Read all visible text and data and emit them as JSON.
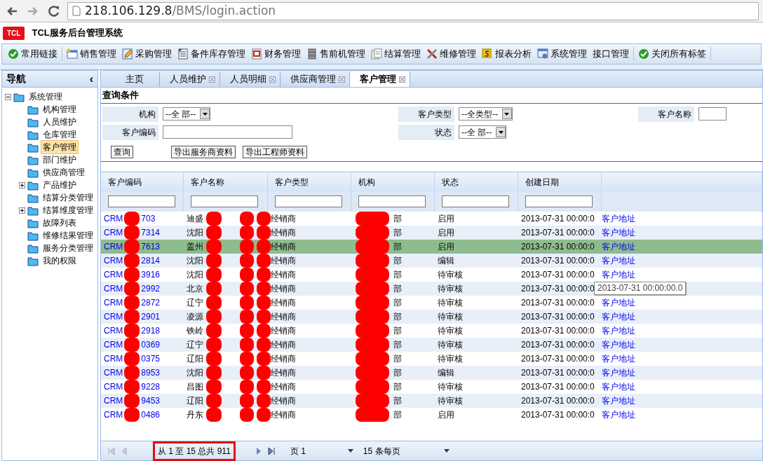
{
  "browser": {
    "url_host": "218.106.129.8",
    "url_path": "/BMS/login.action"
  },
  "app": {
    "logo": "TCL",
    "title": "TCL服务后台管理系统"
  },
  "toolbar": [
    {
      "label": "常用链接"
    },
    {
      "label": "销售管理"
    },
    {
      "label": "采购管理"
    },
    {
      "label": "备件库存管理"
    },
    {
      "label": "财务管理"
    },
    {
      "label": "售前机管理"
    },
    {
      "label": "结算管理"
    },
    {
      "label": "维修管理"
    },
    {
      "label": "报表分析"
    },
    {
      "label": "系统管理"
    },
    {
      "label": "接口管理"
    },
    {
      "label": "关闭所有标签"
    }
  ],
  "sidebar": {
    "title": "导航",
    "collapse": "‹",
    "tree": [
      {
        "label": "系统管理",
        "expanded": true,
        "selected": false,
        "children": [
          {
            "label": "机构管理",
            "selected": false
          },
          {
            "label": "人员维护",
            "selected": false
          },
          {
            "label": "仓库管理",
            "selected": false
          },
          {
            "label": "客户管理",
            "selected": true
          },
          {
            "label": "部门维护",
            "selected": false
          },
          {
            "label": "供应商管理",
            "selected": false
          },
          {
            "label": "产品维护",
            "expanded": false,
            "selected": false
          },
          {
            "label": "结算分类管理",
            "selected": false
          },
          {
            "label": "结算维度管理",
            "expanded": false,
            "selected": false
          },
          {
            "label": "故障列表",
            "selected": false
          },
          {
            "label": "维修结果管理",
            "selected": false
          },
          {
            "label": "服务分类管理",
            "selected": false
          },
          {
            "label": "我的权限",
            "selected": false
          }
        ]
      }
    ]
  },
  "tabs": [
    {
      "label": "主页",
      "closable": false,
      "selected": false
    },
    {
      "label": "人员维护",
      "closable": true,
      "selected": false
    },
    {
      "label": "人员明细",
      "closable": true,
      "selected": false
    },
    {
      "label": "供应商管理",
      "closable": true,
      "selected": false
    },
    {
      "label": "客户管理",
      "closable": true,
      "selected": true
    }
  ],
  "query": {
    "title": "查询条件",
    "fields": [
      {
        "label": "机构",
        "kind": "select",
        "value": "--全 部--"
      },
      {
        "label": "客户类型",
        "kind": "select",
        "value": "--全类型--"
      },
      {
        "label": "客户名称",
        "kind": "input"
      },
      {
        "label": "客户编码",
        "kind": "input"
      },
      {
        "label": "状态",
        "kind": "select",
        "value": "--全 部--"
      }
    ],
    "buttons": [
      "查询",
      "导出服务商资料",
      "导出工程师资料"
    ]
  },
  "table": {
    "columns": [
      "客户编码",
      "客户名称",
      "客户类型",
      "机构",
      "状态",
      "创建日期"
    ],
    "rows": [
      {
        "code": [
          "CRM",
          "703"
        ],
        "name": "迪盛",
        "type": "经销商",
        "org": "部",
        "status": "启用",
        "created": "2013-07-31 00:00:0",
        "link": "客户地址",
        "selected": false
      },
      {
        "code": [
          "CRM",
          "7314"
        ],
        "name": "沈阳",
        "type": "经销商",
        "org": "部",
        "status": "启用",
        "created": "2013-07-31 00:00:0",
        "link": "客户地址",
        "selected": false
      },
      {
        "code": [
          "CRM",
          "7613"
        ],
        "name": "盖州",
        "type": "经销商",
        "org": "部",
        "status": "启用",
        "created": "2013-07-31 00:00:0",
        "link": "客户地址",
        "selected": true
      },
      {
        "code": [
          "CRM",
          "2814"
        ],
        "name": "沈阳",
        "type": "经销商",
        "org": "部",
        "status": "编辑",
        "created": "2013-07-31 00:00:0",
        "link": "客户地址",
        "selected": false
      },
      {
        "code": [
          "CRM",
          "3916"
        ],
        "name": "沈阳",
        "type": "经销商",
        "org": "部",
        "status": "待审核",
        "created": "2013-07-31 00:00:0",
        "link": "客户地址",
        "selected": false
      },
      {
        "code": [
          "CRM",
          "2992"
        ],
        "name": "北京",
        "type": "经销商",
        "org": "部",
        "status": "待审核",
        "created": "2013-07-31 00:00:0",
        "selected": false
      },
      {
        "code": [
          "CRM",
          "2872"
        ],
        "name": "辽宁",
        "type": "经销商",
        "org": "部",
        "status": "待审核",
        "created": "2013-07-31 00:00:0",
        "link": "客户地址",
        "selected": false
      },
      {
        "code": [
          "CRM",
          "2901"
        ],
        "name": "凌源",
        "type": "经销商",
        "org": "部",
        "status": "待审核",
        "created": "2013-07-31 00:00:0",
        "link": "客户地址",
        "selected": false
      },
      {
        "code": [
          "CRM",
          "2918"
        ],
        "name": "铁岭",
        "type": "经销商",
        "org": "部",
        "status": "待审核",
        "created": "2013-07-31 00:00:0",
        "link": "客户地址",
        "selected": false
      },
      {
        "code": [
          "CRM",
          "0369"
        ],
        "name": "辽宁",
        "type": "经销商",
        "org": "部",
        "status": "待审核",
        "created": "2013-07-31 00:00:0",
        "link": "客户地址",
        "selected": false
      },
      {
        "code": [
          "CRM",
          "0375"
        ],
        "name": "辽阳",
        "type": "经销商",
        "org": "部",
        "status": "待审核",
        "created": "2013-07-31 00:00:0",
        "link": "客户地址",
        "selected": false
      },
      {
        "code": [
          "CRM",
          "8953"
        ],
        "name": "沈阳",
        "type": "经销商",
        "org": "部",
        "status": "编辑",
        "created": "2013-07-31 00:00:0",
        "link": "客户地址",
        "selected": false
      },
      {
        "code": [
          "CRM",
          "9228"
        ],
        "name": "昌图",
        "type": "经销商",
        "org": "部",
        "status": "待审核",
        "created": "2013-07-31 00:00:0",
        "link": "客户地址",
        "selected": false
      },
      {
        "code": [
          "CRM",
          "9453"
        ],
        "name": "辽阳",
        "type": "经销商",
        "org": "部",
        "status": "待审核",
        "created": "2013-07-31 00:00:0",
        "link": "客户地址",
        "selected": false
      },
      {
        "code": [
          "CRM",
          "0486"
        ],
        "name": "丹东",
        "type": "经销商",
        "org": "部",
        "status": "启用",
        "created": "2013-07-31 00:00:0",
        "link": "客户地址",
        "selected": false
      }
    ],
    "tooltip": "2013-07-31 00:00:00.0"
  },
  "pager": {
    "info": "从 1 至 15 总共 911",
    "page": "页 1",
    "per_page": "15 条每页"
  }
}
